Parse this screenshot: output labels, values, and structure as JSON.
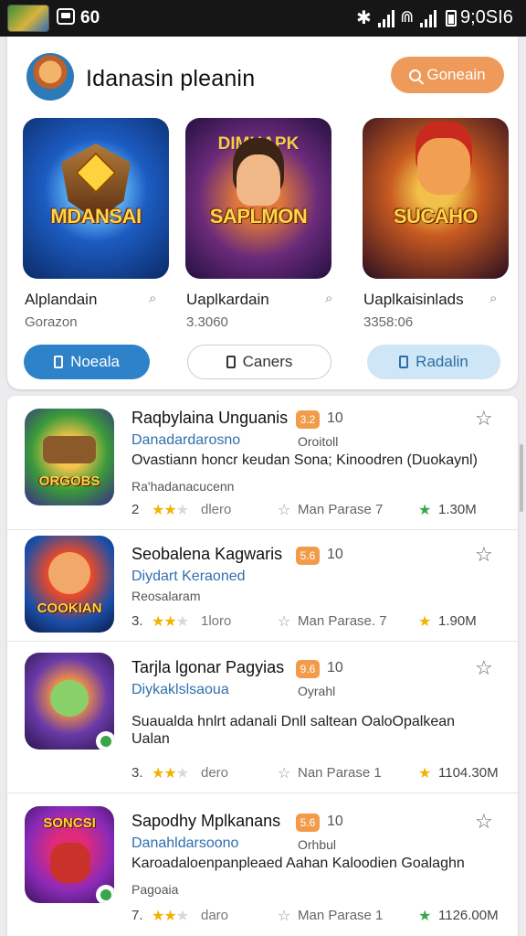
{
  "status_bar": {
    "app_icon": "game-app-icon",
    "left_text": "60",
    "bluetooth": "✱",
    "wifi": "⋒",
    "time": "9;0SI6"
  },
  "header": {
    "title": "Idanasin pleanin",
    "search_label": "Goneain"
  },
  "featured": [
    {
      "logo": "MDANSAI",
      "top": "",
      "name": "Alplandain",
      "sub": "Gorazon",
      "icon_glyph": "⌕"
    },
    {
      "logo": "SAPLMON",
      "top": "DIMUAPK",
      "name": "Uaplkardain",
      "sub": "3.3060",
      "icon_glyph": "⌕"
    },
    {
      "logo": "SUCAHO",
      "top": "",
      "name": "Uaplkaisinlads",
      "sub": "3358:06",
      "icon_glyph": "⌕"
    }
  ],
  "pills": {
    "primary": "Noeala",
    "secondary": "Caners",
    "tertiary": "Radalin"
  },
  "apps": [
    {
      "title": "Raqbylaina Unguanis",
      "badge": "3.2",
      "num": "10",
      "subtitle": "Danadardarosno",
      "subtitle2": "Oroitoll",
      "desc": "Ovastiann honcr keudan Sona; Kinoodren (Duokaynl)",
      "small": "Ra'hadanacucenn",
      "count": "2",
      "stars": 2.5,
      "reviews": "dlero",
      "meta": "Man Parase  7",
      "size": "1.30M",
      "size_star_color": "#3aa64a",
      "icon_text": "ORGOBS"
    },
    {
      "title": "Seobalena Kagwaris",
      "badge": "5.6",
      "num": "10",
      "subtitle": "Diydart Keraoned",
      "subtitle2": "",
      "desc": "",
      "small": "Reosalaram",
      "count": "3.",
      "stars": 2.5,
      "reviews": "1loro",
      "meta": "Man Parase. 7",
      "size": "1.90M",
      "size_star_color": "#f0b400",
      "icon_text": "COOKIAN"
    },
    {
      "title": "Tarjla lgonar Pagyias",
      "badge": "9.6",
      "num": "10",
      "subtitle": "Diykaklslsaoua",
      "subtitle2": "Oyrahl",
      "desc": "Suaualda hnlrt adanali Dnll saltean OaloOpalkean Ualan",
      "small": "",
      "count": "3.",
      "stars": 2.5,
      "reviews": "dero",
      "meta": "Nan Parase  1",
      "size": "1104.30M",
      "size_star_color": "#f0b400",
      "icon_text": ""
    },
    {
      "title": "Sapodhy Mplkanans",
      "badge": "5.6",
      "num": "10",
      "subtitle": "Danahldarsoono",
      "subtitle2": "Orhbul",
      "desc": "Karoadaloenpanpleaed Aahan Kaloodien Goalaghn",
      "small": "Pagoaia",
      "count": "7.",
      "stars": 2.5,
      "reviews": "daro",
      "meta": "Man Parase  1",
      "size": "1126.00M",
      "size_star_color": "#3aa64a",
      "icon_text": "SONCSI"
    }
  ],
  "colors": {
    "accent_orange": "#ee9a5a",
    "primary_blue": "#2e82c9",
    "star_gold": "#f0b400",
    "link_blue": "#2f6fb0"
  }
}
